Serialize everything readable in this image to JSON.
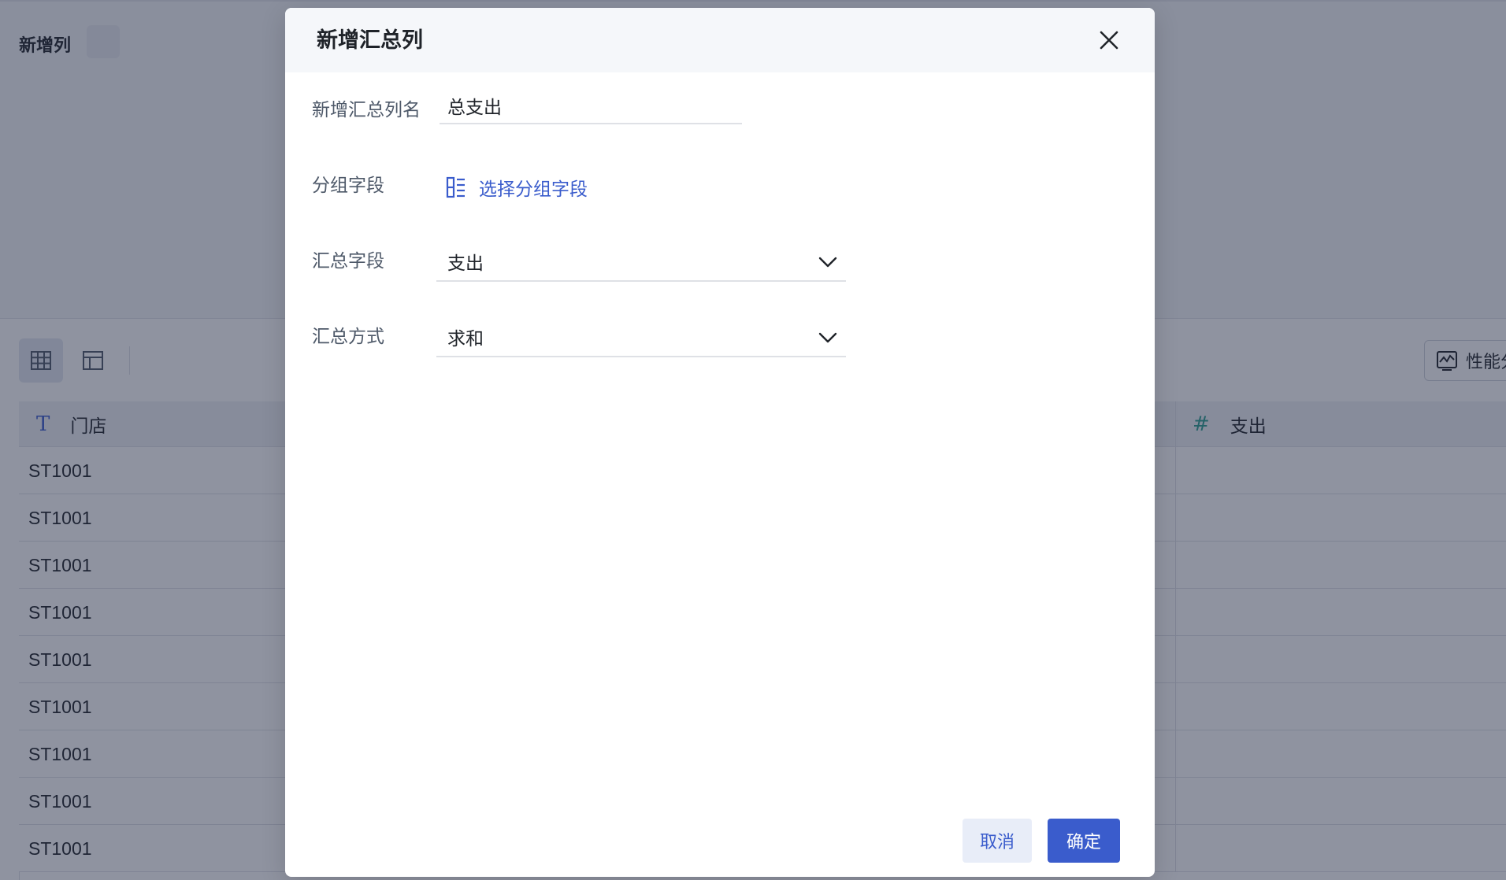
{
  "page": {
    "title": "新增列",
    "performance_label": "性能分"
  },
  "grid": {
    "columns": [
      {
        "label": "门店",
        "type_icon": "text-type-icon"
      },
      {
        "label": "支出",
        "type_icon": "number-type-icon"
      }
    ],
    "rows": [
      {
        "store": "ST1001",
        "expense": ""
      },
      {
        "store": "ST1001",
        "expense": ""
      },
      {
        "store": "ST1001",
        "expense": ""
      },
      {
        "store": "ST1001",
        "expense": ""
      },
      {
        "store": "ST1001",
        "expense": ""
      },
      {
        "store": "ST1001",
        "expense": ""
      },
      {
        "store": "ST1001",
        "expense": ""
      },
      {
        "store": "ST1001",
        "expense": ""
      },
      {
        "store": "ST1001",
        "expense": ""
      }
    ]
  },
  "modal": {
    "title": "新增汇总列",
    "fields": {
      "name": {
        "label": "新增汇总列名",
        "value": "总支出"
      },
      "group": {
        "label": "分组字段",
        "link_text": "选择分组字段"
      },
      "summary_field": {
        "label": "汇总字段",
        "value": "支出"
      },
      "summary_method": {
        "label": "汇总方式",
        "value": "求和"
      }
    },
    "buttons": {
      "cancel": "取消",
      "ok": "确定"
    }
  },
  "colors": {
    "accent": "#3a5ccc",
    "overlay": "rgba(31,40,66,0.5)",
    "number_type": "#2a9d8f"
  }
}
